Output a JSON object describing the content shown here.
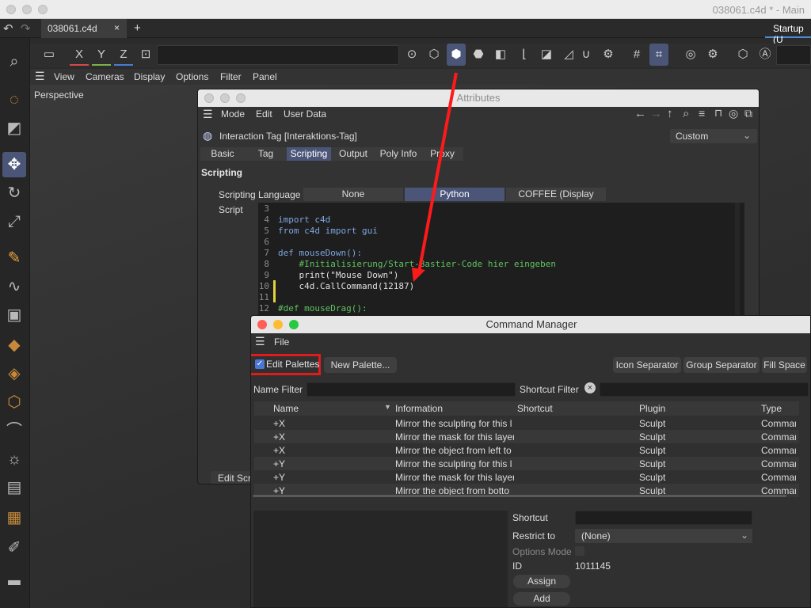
{
  "window": {
    "app_title": "038061.c4d * - Main"
  },
  "tabs": {
    "doc_tab": "038061.c4d",
    "close_glyph": "×",
    "add_glyph": "+",
    "layout": "Startup (U"
  },
  "toolbar": {
    "x": "X",
    "y": "Y",
    "z": "Z"
  },
  "viewport": {
    "menu": [
      "View",
      "Cameras",
      "Display",
      "Options",
      "Filter",
      "Panel"
    ],
    "camera_label": "Perspective"
  },
  "attributes": {
    "title": "Attributes",
    "menu": [
      "Mode",
      "Edit",
      "User Data"
    ],
    "object_label": "Interaction Tag [Interaktions-Tag]",
    "preset": "Custom",
    "tabs": [
      "Basic",
      "Tag",
      "Scripting",
      "Output",
      "Poly Info",
      "Proxy"
    ],
    "section": "Scripting",
    "scripting_language_label": "Scripting Language",
    "languages": [
      "None",
      "Python",
      "COFFEE (Display Only)"
    ],
    "script_label": "Script",
    "code_lines": [
      {
        "n": "3",
        "t": ""
      },
      {
        "n": "4",
        "t": "import c4d"
      },
      {
        "n": "5",
        "t": "from c4d import gui"
      },
      {
        "n": "6",
        "t": ""
      },
      {
        "n": "7",
        "t": "def mouseDown():"
      },
      {
        "n": "8",
        "t": "    #Initialisierung/Start-Bastier-Code hier eingeben"
      },
      {
        "n": "9",
        "t": "    print(\"Mouse Down\")"
      },
      {
        "n": "10",
        "t": "    c4d.CallCommand(12187)"
      },
      {
        "n": "11",
        "t": ""
      },
      {
        "n": "12",
        "t": "#def mouseDrag():"
      }
    ],
    "edit_script_button": "Edit Scr"
  },
  "command_manager": {
    "title": "Command Manager",
    "menu_file": "File",
    "edit_palettes_label": "Edit Palettes",
    "new_palette_button": "New Palette...",
    "icon_separator_button": "Icon Separator",
    "group_separator_button": "Group Separator",
    "fill_space_button": "Fill Space",
    "name_filter_label": "Name Filter",
    "shortcut_filter_label": "Shortcut Filter",
    "columns": [
      "Name",
      "Information",
      "Shortcut",
      "Plugin",
      "Type"
    ],
    "rows": [
      {
        "name": "+X",
        "info": "Mirror the sculpting for this l",
        "shortcut": "",
        "plugin": "Sculpt",
        "type": "Comman"
      },
      {
        "name": "+X",
        "info": "Mirror the mask for this layer",
        "shortcut": "",
        "plugin": "Sculpt",
        "type": "Comman"
      },
      {
        "name": "+X",
        "info": "Mirror the object from left to",
        "shortcut": "",
        "plugin": "Sculpt",
        "type": "Comman"
      },
      {
        "name": "+Y",
        "info": "Mirror the sculpting for this l",
        "shortcut": "",
        "plugin": "Sculpt",
        "type": "Comman"
      },
      {
        "name": "+Y",
        "info": "Mirror the mask for this layer",
        "shortcut": "",
        "plugin": "Sculpt",
        "type": "Comman"
      },
      {
        "name": "+Y",
        "info": "Mirror the object from botto",
        "shortcut": "",
        "plugin": "Sculpt",
        "type": "Comman"
      }
    ],
    "detail": {
      "shortcut_label": "Shortcut",
      "restrict_label": "Restrict to",
      "restrict_value": "(None)",
      "options_mode_label": "Options Mode",
      "id_label": "ID",
      "id_value": "1011145",
      "assign_button": "Assign",
      "add_button": "Add"
    }
  },
  "colors": {
    "accent": "#4a5578",
    "annotation": "#ff1a1a",
    "python_green": "#5ec25e",
    "keyword": "#7ea6e0"
  }
}
